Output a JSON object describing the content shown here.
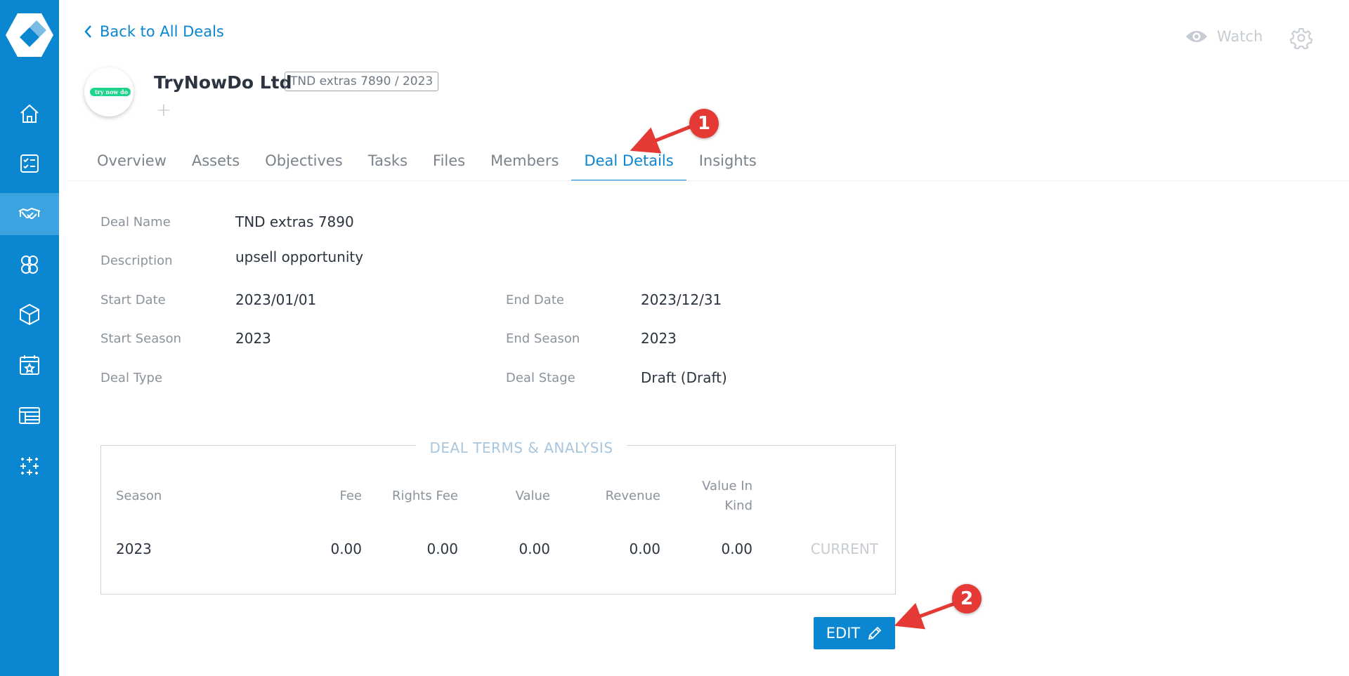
{
  "header": {
    "back_label": "Back to All Deals",
    "watch_label": "Watch"
  },
  "company": {
    "name": "TryNowDo Ltd",
    "logo_text": "try now do",
    "deal_badge": "TND extras 7890 / 2023",
    "add_symbol": "+"
  },
  "tabs": [
    {
      "label": "Overview"
    },
    {
      "label": "Assets"
    },
    {
      "label": "Objectives"
    },
    {
      "label": "Tasks"
    },
    {
      "label": "Files"
    },
    {
      "label": "Members"
    },
    {
      "label": "Deal Details"
    },
    {
      "label": "Insights"
    }
  ],
  "active_tab": "Deal Details",
  "details": {
    "deal_name_label": "Deal Name",
    "deal_name": "TND extras 7890",
    "description_label": "Description",
    "description": "upsell opportunity",
    "start_date_label": "Start Date",
    "start_date": "2023/01/01",
    "end_date_label": "End Date",
    "end_date": "2023/12/31",
    "start_season_label": "Start Season",
    "start_season": "2023",
    "end_season_label": "End Season",
    "end_season": "2023",
    "deal_type_label": "Deal Type",
    "deal_type": "",
    "deal_stage_label": "Deal Stage",
    "deal_stage": "Draft (Draft)"
  },
  "terms": {
    "title": "DEAL TERMS & ANALYSIS",
    "headers": {
      "season": "Season",
      "fee": "Fee",
      "rights_fee": "Rights Fee",
      "value": "Value",
      "revenue": "Revenue",
      "value_in_kind_1": "Value In",
      "value_in_kind_2": "Kind"
    },
    "rows": [
      {
        "season": "2023",
        "fee": "0.00",
        "rights_fee": "0.00",
        "value": "0.00",
        "revenue": "0.00",
        "value_in_kind": "0.00",
        "status": "CURRENT"
      }
    ]
  },
  "edit_label": "EDIT",
  "annotations": {
    "callout_1": "1",
    "callout_2": "2"
  },
  "colors": {
    "primary": "#0b86d1",
    "sidebar_active": "#3aa3e0",
    "callout": "#e53935"
  }
}
